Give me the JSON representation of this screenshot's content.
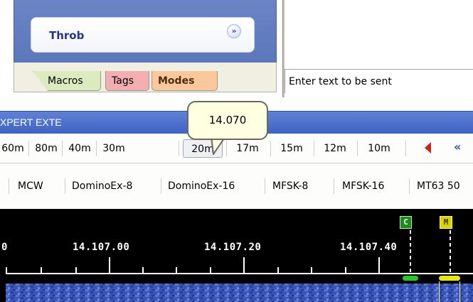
{
  "mode_panel": {
    "selected_mode": "Throb",
    "expand_icon": "double-chevron-down-icon",
    "tabs": [
      {
        "label": "Macros",
        "color": "#dcebbd"
      },
      {
        "label": "Tags",
        "color": "#f3aeb2"
      },
      {
        "label": "Modes",
        "color": "#fbc89b",
        "active": true
      }
    ]
  },
  "transmit": {
    "placeholder": "Enter text to be sent"
  },
  "toolbar": {
    "title": "XPERT EXTE",
    "bands": [
      "30m",
      "80m",
      "40m",
      "30m",
      "20m",
      "17m",
      "15m",
      "12m",
      "10m"
    ],
    "selected_band": "20m",
    "band_first_visible": "60m",
    "prev_icon": "red-triangle-left-icon",
    "rewind_icon": "double-chevron-left-icon",
    "tooltip": "14.070"
  },
  "modes_bar": {
    "modes": [
      "MCW",
      "DominoEx-8",
      "DominoEx-16",
      "MFSK-8",
      "MFSK-16",
      "MT63 50"
    ]
  },
  "waterfall": {
    "freq_labels": [
      "0",
      "14.107.00",
      "14.107.20",
      "14.107.40"
    ],
    "marker_c": "C",
    "marker_m": "M",
    "colors": {
      "background": "#000000",
      "marker_c": "#1a8c1a",
      "marker_m": "#d9d400",
      "noise": "#3a55b8"
    }
  }
}
